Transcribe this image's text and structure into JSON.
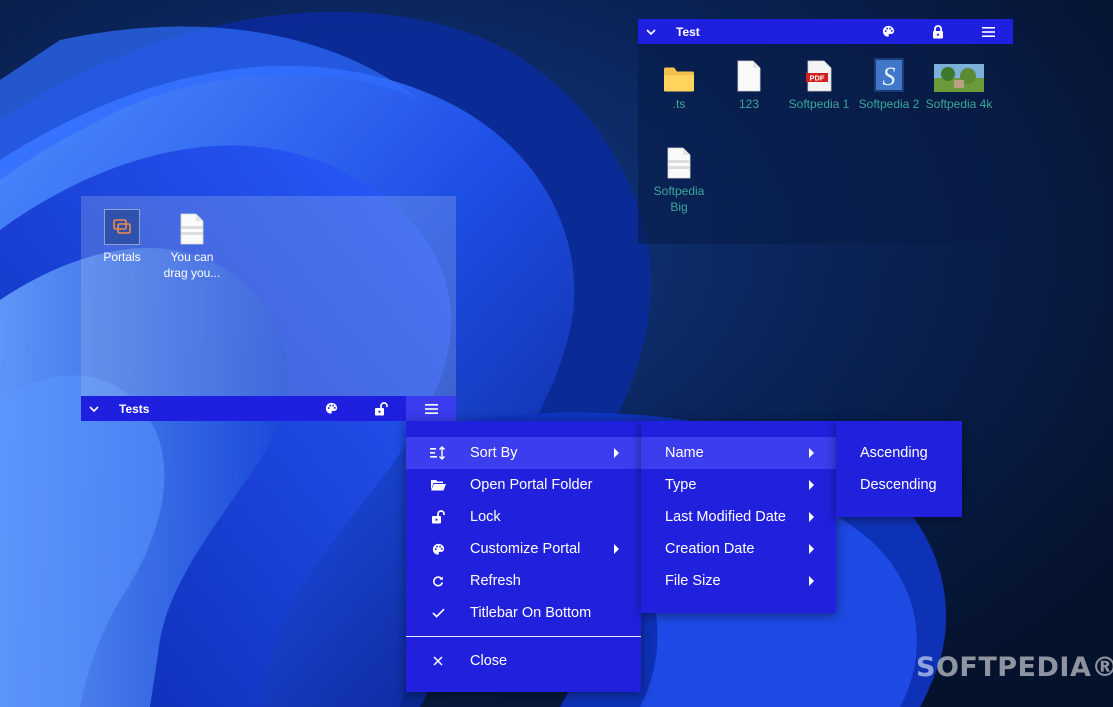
{
  "portals": [
    {
      "title": "Test",
      "files": [
        {
          "label": ".ts",
          "icon": "folder-icon"
        },
        {
          "label": "123",
          "icon": "blank-file-icon"
        },
        {
          "label": "Softpedia 1",
          "icon": "pdf-file-icon"
        },
        {
          "label": "Softpedia 2",
          "icon": "image-file-icon"
        },
        {
          "label": "Softpedia 4k",
          "icon": "photo-file-icon"
        },
        {
          "label": "Softpedia Big",
          "icon": "text-file-icon"
        }
      ]
    },
    {
      "title": "Tests",
      "files": [
        {
          "label": "Portals",
          "icon": "portals-app-icon"
        },
        {
          "label": "You can drag you...",
          "icon": "text-file-icon"
        }
      ]
    }
  ],
  "pdf_badge": "PDF",
  "image_badge": "S",
  "context_menu": {
    "items": [
      {
        "label": "Sort By",
        "icon": "sort-icon"
      },
      {
        "label": "Open Portal Folder",
        "icon": "folder-open-icon"
      },
      {
        "label": "Lock",
        "icon": "lock-open-icon"
      },
      {
        "label": "Customize Portal",
        "icon": "palette-icon"
      },
      {
        "label": "Refresh",
        "icon": "refresh-icon"
      },
      {
        "label": "Titlebar On Bottom",
        "icon": "check-icon"
      },
      {
        "label": "Close",
        "icon": "close-icon"
      }
    ]
  },
  "sort_menu": {
    "items": [
      "Name",
      "Type",
      "Last Modified Date",
      "Creation Date",
      "File Size"
    ]
  },
  "order_menu": {
    "items": [
      "Ascending",
      "Descending"
    ]
  },
  "watermark": "SOFTPEDIA®",
  "colors": {
    "titlebar": "#1f1fe0",
    "menu_bg": "#2121dd",
    "menu_highlight": "#3d3df0",
    "portal_top_text": "#3aa89a",
    "portal_bottom_text": "#ffffff"
  }
}
